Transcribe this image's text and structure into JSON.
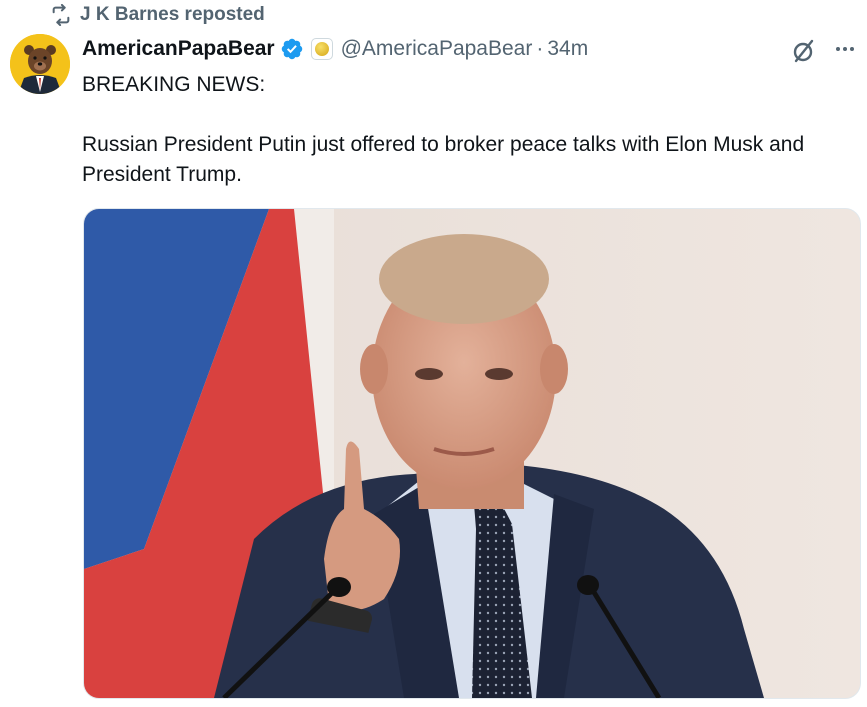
{
  "repost": {
    "icon": "repost-icon",
    "text": "J K Barnes reposted"
  },
  "author": {
    "display_name": "AmericanPapaBear",
    "verified_badge": "verified-badge-icon",
    "affiliate_badge": "gold-coin-badge-icon",
    "handle": "@AmericaPapaBear",
    "separator": "·",
    "time": "34m",
    "avatar": "bear-in-suit-avatar"
  },
  "actions": {
    "grok_icon": "grok-icon",
    "more_icon": "more-options-icon"
  },
  "tweet": {
    "line1": "BREAKING NEWS:",
    "line2": "Russian President Putin just offered to broker peace talks with Elon Musk and President Trump."
  },
  "media": {
    "type": "photo",
    "alt": "Man in dark suit pointing finger upward at a podium microphone, Russian flag in background"
  },
  "colors": {
    "verified_blue": "#1d9bf0",
    "secondary_text": "#536471",
    "flag_blue": "#2f5aa8",
    "flag_red": "#d9413f",
    "avatar_bg": "#f4c21a"
  }
}
